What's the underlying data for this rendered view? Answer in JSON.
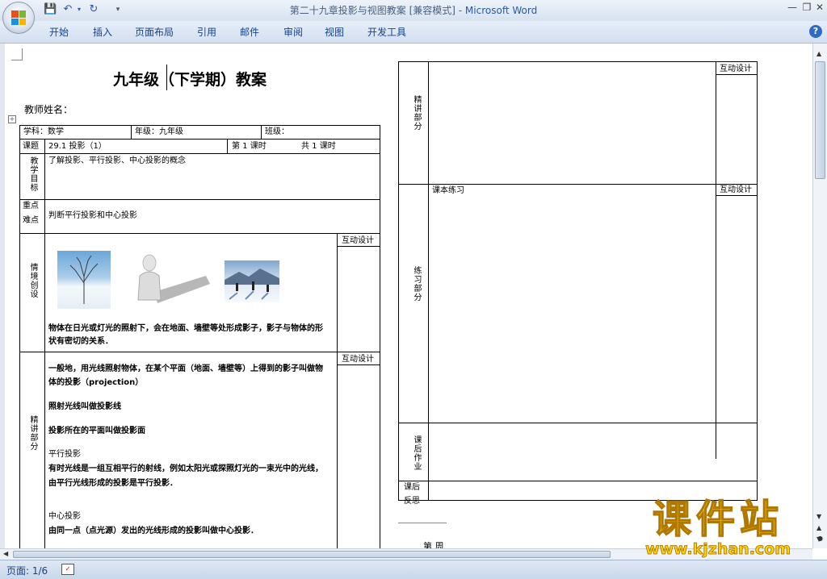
{
  "window": {
    "title_doc": "第二十九章投影与视图教案 [兼容模式] - ",
    "title_app": "Microsoft Word"
  },
  "ribbon": {
    "tabs": [
      "开始",
      "插入",
      "页面布局",
      "引用",
      "邮件",
      "审阅",
      "视图",
      "开发工具"
    ]
  },
  "doc": {
    "heading": "九年级（下学期）教案",
    "teacher": "教师姓名：",
    "subject": "学科：数学",
    "grade": "年级：九年级",
    "class": "班级：",
    "topic_label": "课题",
    "topic": "29.1  投影（1）",
    "lesson_no": "第    1  课时",
    "lesson_total": "共  1    课时",
    "goal_label": "教学目标",
    "goal": "了解投影、平行投影、中心投影的概念",
    "key_label1": "重点",
    "key_label2": "难点",
    "key": "判断平行投影和中心投影",
    "scene_label": "情境创设",
    "scene_text1": "物体在日光或灯光的照射下，会在地面、墙壁等处形成影子，影子与物体的形",
    "scene_text2": "状有密切的关系．",
    "interact": "互动设计",
    "lecture_label": "精讲部分",
    "lec1": "一般地，用光线照射物体，在某个平面（地面、墙壁等）上得到的影子叫做物",
    "lec2": "体的投影（projection）",
    "lec3": "照射光线叫做投影线",
    "lec4": "投影所在的平面叫做投影面",
    "lec5": "平行投影",
    "lec6": "有时光线是一组互相平行的射线，例如太阳光或探照灯光的一束光中的光线，",
    "lec7": "由平行光线形成的投影是平行投影．",
    "lec8": "中心投影",
    "lec9": "由同一点（点光源）发出的光线形成的投影叫做中心投影．",
    "r_lecture_label": "精讲部分",
    "r_practice_label": "练习部分",
    "r_practice_text": "课本练习",
    "r_homework_label": "课后作业",
    "r_reflect_label1": "课后",
    "r_reflect_label2": "反思",
    "r_footer": "第      周"
  },
  "status": {
    "page": "页面: 1/6"
  },
  "watermark": {
    "text": "课件站",
    "url": "www.kjzhan.com"
  }
}
